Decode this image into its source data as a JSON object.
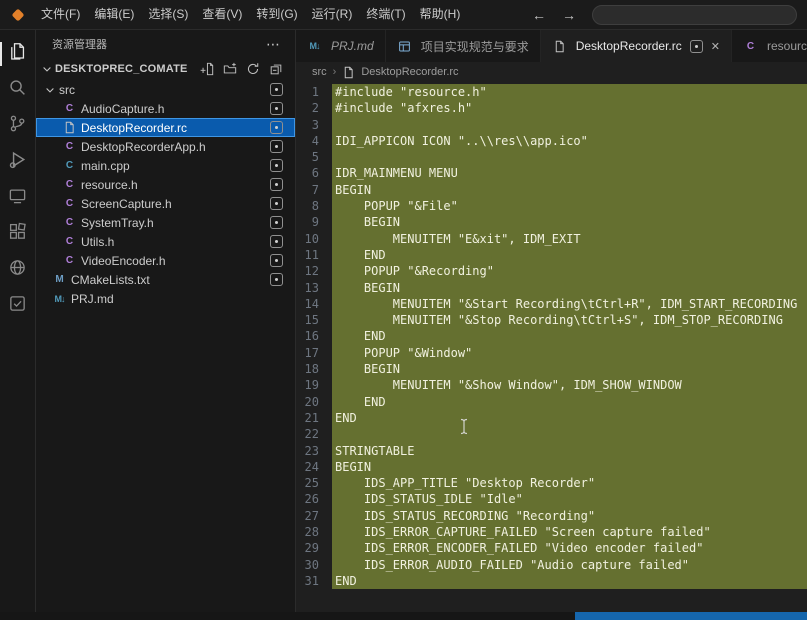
{
  "icons": {
    "more": "⋯",
    "back": "←",
    "forward": "→",
    "close": "✕",
    "breadcrumb_sep": "›"
  },
  "colors": {
    "highlight": "#657030",
    "selection_bg": "#0a5bad",
    "selection_border": "#3f96e4",
    "status_blue": "#1566ad",
    "logo_orange": "#e2802a"
  },
  "titlebar": {
    "menus": [
      "文件(F)",
      "编辑(E)",
      "选择(S)",
      "查看(V)",
      "转到(G)",
      "运行(R)",
      "终端(T)",
      "帮助(H)"
    ]
  },
  "activity_bar": [
    {
      "name": "explorer",
      "icon": "files-icon",
      "active": true
    },
    {
      "name": "search",
      "icon": "search-icon",
      "active": false
    },
    {
      "name": "source-control",
      "icon": "source-control-icon",
      "active": false
    },
    {
      "name": "run-debug",
      "icon": "run-debug-icon",
      "active": false
    },
    {
      "name": "remote-explorer",
      "icon": "monitor-icon",
      "active": false
    },
    {
      "name": "extensions",
      "icon": "extensions-icon",
      "active": false
    },
    {
      "name": "comate",
      "icon": "globe-icon",
      "active": false
    },
    {
      "name": "tasks",
      "icon": "checklist-icon",
      "active": false
    }
  ],
  "sidebar": {
    "title": "资源管理器",
    "section": "DESKTOPREC_COMATE",
    "actions": [
      "new-file",
      "new-folder",
      "refresh",
      "collapse-all"
    ],
    "tree": [
      {
        "label": "src",
        "kind": "folder",
        "depth": 1,
        "badge": true
      },
      {
        "label": "AudioCapture.h",
        "kind": "h",
        "depth": 2,
        "badge": true
      },
      {
        "label": "DesktopRecorder.rc",
        "kind": "rc",
        "depth": 2,
        "badge": true,
        "selected": true
      },
      {
        "label": "DesktopRecorderApp.h",
        "kind": "h",
        "depth": 2,
        "badge": true
      },
      {
        "label": "main.cpp",
        "kind": "cpp",
        "depth": 2,
        "badge": true
      },
      {
        "label": "resource.h",
        "kind": "h",
        "depth": 2,
        "badge": true
      },
      {
        "label": "ScreenCapture.h",
        "kind": "h",
        "depth": 2,
        "badge": true
      },
      {
        "label": "SystemTray.h",
        "kind": "h",
        "depth": 2,
        "badge": true
      },
      {
        "label": "Utils.h",
        "kind": "h",
        "depth": 2,
        "badge": true
      },
      {
        "label": "VideoEncoder.h",
        "kind": "h",
        "depth": 2,
        "badge": true
      },
      {
        "label": "CMakeLists.txt",
        "kind": "cmake",
        "depth": 1,
        "badge": true
      },
      {
        "label": "PRJ.md",
        "kind": "md",
        "depth": 1,
        "badge": false
      }
    ]
  },
  "tabs": [
    {
      "label": "PRJ.md",
      "kind": "md",
      "state": "preview"
    },
    {
      "label": "项目实现规范与要求",
      "kind": "doc",
      "state": "normal"
    },
    {
      "label": "DesktopRecorder.rc",
      "kind": "rc",
      "state": "active",
      "badge": true,
      "closable": true
    },
    {
      "label": "resource.h",
      "kind": "h",
      "state": "normal"
    }
  ],
  "breadcrumb": {
    "folder": "src",
    "file": "DesktopRecorder.rc"
  },
  "editor": {
    "highlight": {
      "from": 1,
      "to": 31
    },
    "lines": [
      "#include \"resource.h\"",
      "#include \"afxres.h\"",
      "",
      "IDI_APPICON ICON \"..\\\\res\\\\app.ico\"",
      "",
      "IDR_MAINMENU MENU",
      "BEGIN",
      "    POPUP \"&File\"",
      "    BEGIN",
      "        MENUITEM \"E&xit\", IDM_EXIT",
      "    END",
      "    POPUP \"&Recording\"",
      "    BEGIN",
      "        MENUITEM \"&Start Recording\\tCtrl+R\", IDM_START_RECORDING",
      "        MENUITEM \"&Stop Recording\\tCtrl+S\", IDM_STOP_RECORDING",
      "    END",
      "    POPUP \"&Window\"",
      "    BEGIN",
      "        MENUITEM \"&Show Window\", IDM_SHOW_WINDOW",
      "    END",
      "END",
      "",
      "STRINGTABLE",
      "BEGIN",
      "    IDS_APP_TITLE \"Desktop Recorder\"",
      "    IDS_STATUS_IDLE \"Idle\"",
      "    IDS_STATUS_RECORDING \"Recording\"",
      "    IDS_ERROR_CAPTURE_FAILED \"Screen capture failed\"",
      "    IDS_ERROR_ENCODER_FAILED \"Video encoder failed\"",
      "    IDS_ERROR_AUDIO_FAILED \"Audio capture failed\"",
      "END"
    ]
  }
}
